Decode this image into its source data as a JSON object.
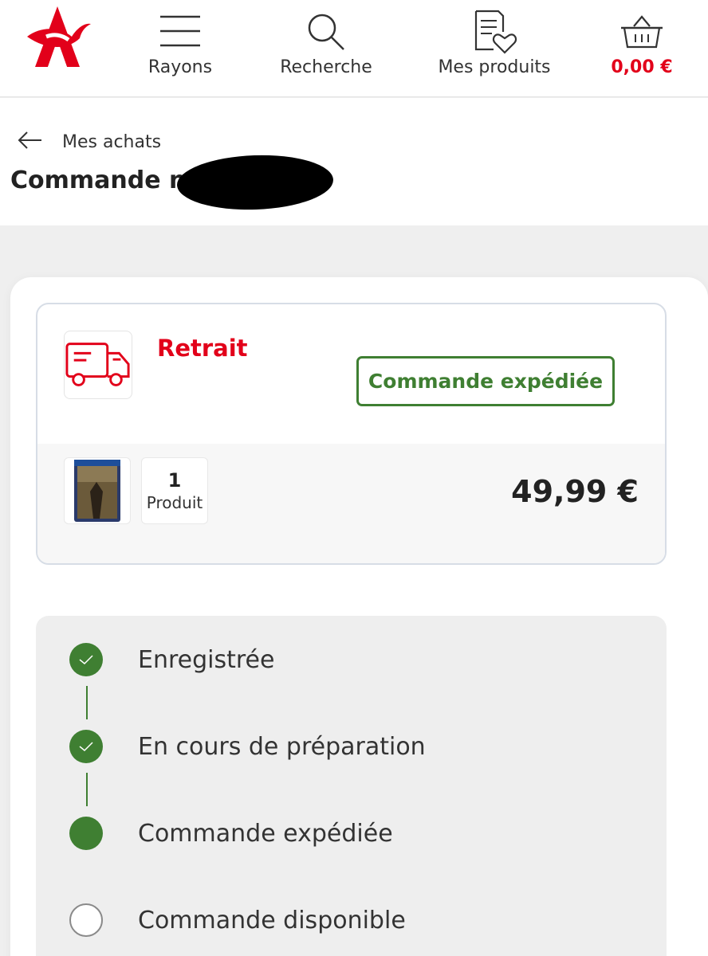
{
  "nav": {
    "rayons": "Rayons",
    "recherche": "Recherche",
    "mes_produits": "Mes produits",
    "panier_total": "0,00 €"
  },
  "header": {
    "back_label": "Mes achats",
    "order_title": "Commande n°"
  },
  "order": {
    "mode": "Retrait",
    "status": "Commande expédiée",
    "quantity": "1",
    "quantity_label": "Produit",
    "price": "49,99 €"
  },
  "tracking": {
    "steps": [
      {
        "label": "Enregistrée",
        "state": "done"
      },
      {
        "label": "En cours de préparation",
        "state": "done"
      },
      {
        "label": "Commande expédiée",
        "state": "current"
      },
      {
        "label": "Commande disponible",
        "state": "todo"
      }
    ]
  },
  "colors": {
    "brand_red": "#e2001a",
    "status_green": "#3f7f32"
  },
  "icons": {
    "logo": "auchan-bird-logo",
    "rayons": "menu-icon",
    "recherche": "search-icon",
    "mes_produits": "list-heart-icon",
    "panier": "basket-icon",
    "back": "arrow-left-icon",
    "mode": "truck-icon",
    "check": "check-icon"
  }
}
